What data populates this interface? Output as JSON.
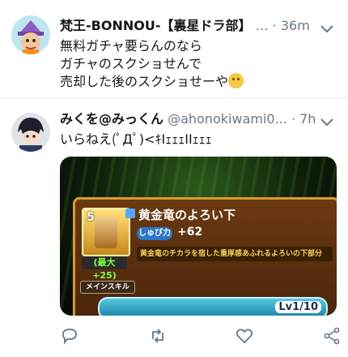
{
  "tweets": [
    {
      "name": "梵王-BONNOU-【裏星ドラ部】",
      "handle": "…",
      "dot": "·",
      "time": "36m",
      "lines": [
        "無料ガチャ要らんのなら",
        "ガチャのスクショせんで",
        "売却した後のスクショせーや"
      ],
      "emoji": "hugging-face"
    },
    {
      "name": "みくを@みっくん",
      "handle": "@ahonokiwami0...",
      "dot": "·",
      "time": "7h",
      "lines": [
        "いらねえ(ﾟДﾟ)<ｷIｪｪｪIIｪｪｪ"
      ],
      "media": {
        "level": "5",
        "bonus": "(最大+25)",
        "item_name": "黄金竜のよろい下",
        "stat_label": "しゅび力",
        "stat_value": "+62",
        "description": "黄金竜のチカラを宿した重厚感あふれるよろいの下部分",
        "skill_tag": "メインスキル",
        "skill_level": "Lv1/10"
      }
    }
  ],
  "actions": [
    "reply-icon",
    "retweet-icon",
    "like-icon",
    "share-icon"
  ]
}
